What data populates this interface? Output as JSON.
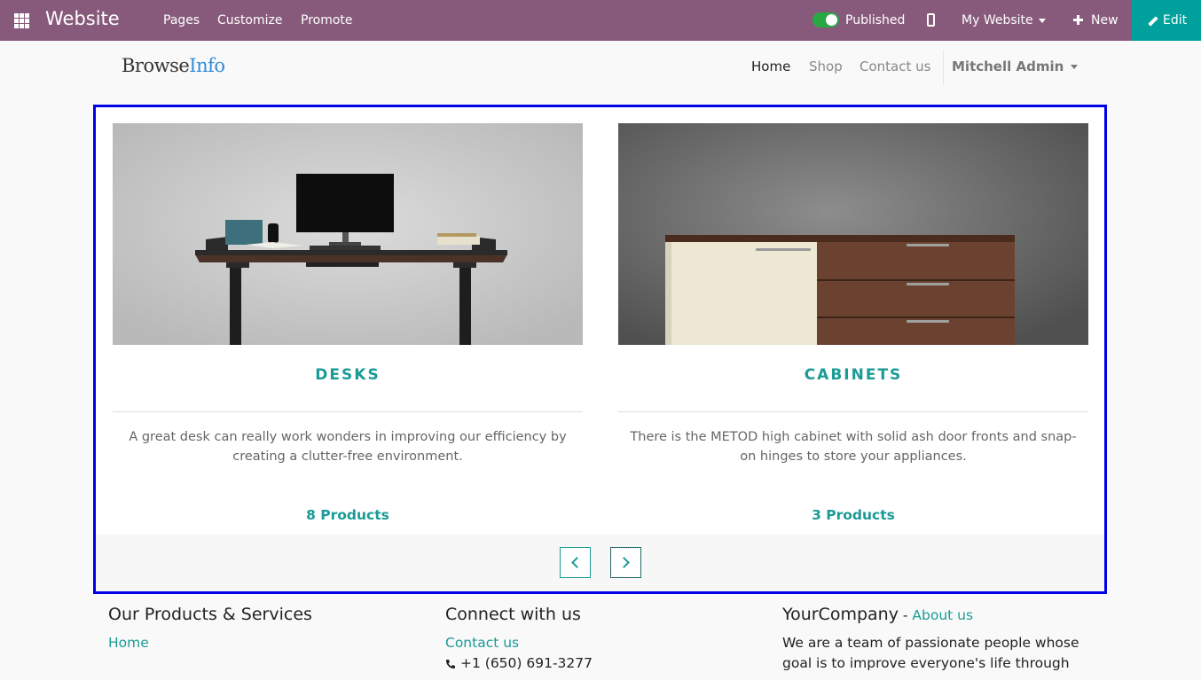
{
  "topbar": {
    "brand": "Website",
    "menu": [
      "Pages",
      "Customize",
      "Promote"
    ],
    "published_label": "Published",
    "website_selector": "My Website",
    "new_label": "New",
    "edit_label": "Edit",
    "bg_color": "#875a7b",
    "edit_color": "#00a09d"
  },
  "header": {
    "logo_part1": "Browse",
    "logo_part2": "Info",
    "nav": [
      "Home",
      "Shop",
      "Contact us"
    ],
    "user": "Mitchell Admin"
  },
  "categories": [
    {
      "title": "DESKS",
      "description": "A great desk can really work wonders in improving our efficiency by creating a clutter-free environment.",
      "count": "8 Products",
      "image": "desk-photo"
    },
    {
      "title": "CABINETS",
      "description": "There is the METOD high cabinet with solid ash door fronts and snap-on hinges to store your appliances.",
      "count": "3 Products",
      "image": "cabinet-photo"
    }
  ],
  "carousel": {
    "prev_icon": "chevron-left-icon",
    "next_icon": "chevron-right-icon",
    "accent_color": "#1a9b95",
    "highlight_color": "#0000e6"
  },
  "footer": {
    "col1_title": "Our Products & Services",
    "col1_link": "Home",
    "col2_title": "Connect with us",
    "col2_link": "Contact us",
    "phone": "+1 (650) 691-3277",
    "col3_title": "YourCompany",
    "col3_sep": " - ",
    "col3_link": "About us",
    "col3_text": "We are a team of passionate people whose goal is to improve everyone's life through"
  }
}
